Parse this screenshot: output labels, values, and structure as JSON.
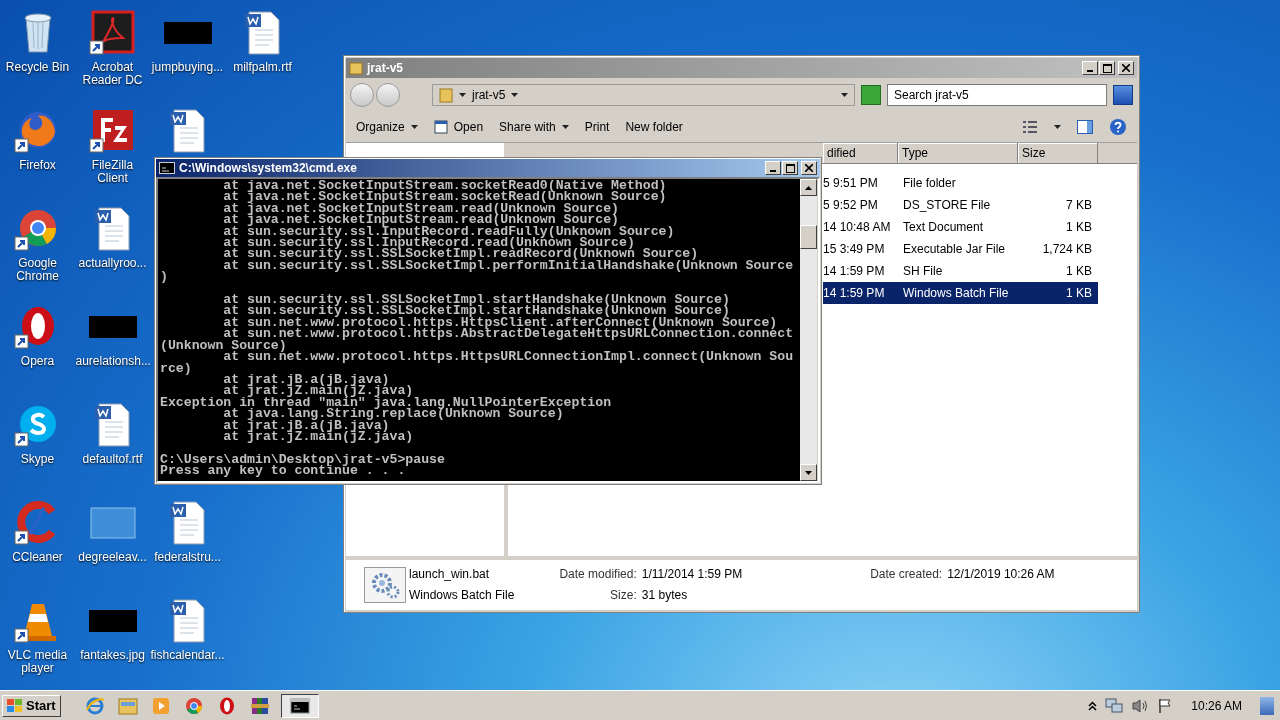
{
  "desktop": {
    "columns": [
      [
        {
          "kind": "recycle",
          "label": "Recycle Bin",
          "shortcut": false
        },
        {
          "kind": "firefox",
          "label": "Firefox",
          "shortcut": true
        },
        {
          "kind": "chrome",
          "label": "Google Chrome",
          "shortcut": true
        },
        {
          "kind": "opera",
          "label": "Opera",
          "shortcut": true
        },
        {
          "kind": "skype",
          "label": "Skype",
          "shortcut": true
        },
        {
          "kind": "ccleaner",
          "label": "CCleaner",
          "shortcut": true
        },
        {
          "kind": "vlc",
          "label": "VLC media player",
          "shortcut": true
        }
      ],
      [
        {
          "kind": "acrobat",
          "label": "Acrobat Reader DC",
          "shortcut": true
        },
        {
          "kind": "filezilla",
          "label": "FileZilla Client",
          "shortcut": true
        },
        {
          "kind": "word",
          "label": "actuallyroo...",
          "shortcut": false
        },
        {
          "kind": "thumb-dark",
          "label": "aurelationsh...",
          "shortcut": false
        },
        {
          "kind": "word",
          "label": "defaultof.rtf",
          "shortcut": false
        },
        {
          "kind": "thumb-light",
          "label": "degreeleav...",
          "shortcut": false
        },
        {
          "kind": "thumb-dark",
          "label": "fantakes.jpg",
          "shortcut": false
        }
      ],
      [
        {
          "kind": "thumb-dark",
          "label": "jumpbuying...",
          "shortcut": false
        },
        {
          "kind": "word",
          "shortcut": false
        },
        {
          "kind": "word",
          "label": "federalstru...",
          "shortcut": false
        },
        {
          "kind": "word",
          "label": "fishcalendar...",
          "shortcut": false
        }
      ],
      [
        {
          "kind": "word",
          "label": "milfpalm.rtf",
          "shortcut": false
        }
      ]
    ]
  },
  "explorer": {
    "title": "jrat-v5",
    "breadcrumb": "jrat-v5",
    "search": {
      "placeholder": "Search jrat-v5"
    },
    "toolbar": [
      {
        "kind": "menu",
        "label": "Organize"
      },
      {
        "kind": "open",
        "label": "Open"
      },
      {
        "kind": "menu",
        "label": "Share with"
      },
      {
        "kind": "plain",
        "label": "Print"
      },
      {
        "kind": "plain",
        "label": "New folder"
      }
    ],
    "columns": [
      "dified",
      "Type",
      "Size"
    ],
    "rows": [
      {
        "date": "5 9:51 PM",
        "type": "File folder",
        "selected": false
      },
      {
        "date": "5 9:52 PM",
        "type": "DS_STORE File",
        "size": "7 KB",
        "selected": false
      },
      {
        "date": "14 10:48 AM",
        "type": "Text Document",
        "size": "1 KB",
        "selected": false
      },
      {
        "date": "15 3:49 PM",
        "type": "Executable Jar File",
        "size": "1,724 KB",
        "selected": false
      },
      {
        "date": "14 1:59 PM",
        "type": "SH File",
        "size": "1 KB",
        "selected": false
      },
      {
        "date": "14 1:59 PM",
        "type": "Windows Batch File",
        "size": "1 KB",
        "selected": true
      }
    ],
    "details": {
      "name": "launch_win.bat",
      "type": "Windows Batch File",
      "fields": [
        {
          "label": "Date modified:",
          "value": "1/11/2014 1:59 PM"
        },
        {
          "label": "Date created:",
          "value": "12/1/2019 10:26 AM"
        },
        {
          "label": "Size:",
          "value": "31 bytes"
        }
      ]
    }
  },
  "console": {
    "title": "C:\\Windows\\system32\\cmd.exe",
    "output": "        at java.net.SocketInputStream.socketRead0(Native Method)\n        at java.net.SocketInputStream.socketRead(Unknown Source)\n        at java.net.SocketInputStream.read(Unknown Source)\n        at java.net.SocketInputStream.read(Unknown Source)\n        at sun.security.ssl.InputRecord.readFully(Unknown Source)\n        at sun.security.ssl.InputRecord.read(Unknown Source)\n        at sun.security.ssl.SSLSocketImpl.readRecord(Unknown Source)\n        at sun.security.ssl.SSLSocketImpl.performInitialHandshake(Unknown Source\n)\n\n        at sun.security.ssl.SSLSocketImpl.startHandshake(Unknown Source)\n        at sun.security.ssl.SSLSocketImpl.startHandshake(Unknown Source)\n        at sun.net.www.protocol.https.HttpsClient.afterConnect(Unknown Source)\n        at sun.net.www.protocol.https.AbstractDelegateHttpsURLConnection.connect\n(Unknown Source)\n        at sun.net.www.protocol.https.HttpsURLConnectionImpl.connect(Unknown Sou\nrce)\n        at jrat.jB.a(jB.java)\n        at jrat.jZ.main(jZ.java)\nException in thread \"main\" java.lang.NullPointerException\n        at java.lang.String.replace(Unknown Source)\n        at jrat.jB.a(jB.java)\n        at jrat.jZ.main(jZ.java)\n\nC:\\Users\\admin\\Desktop\\jrat-v5>pause\nPress any key to continue . . ."
  },
  "taskbar": {
    "start": "Start",
    "apps": [
      {
        "kind": "ie",
        "selected": false
      },
      {
        "kind": "folder",
        "selected": false
      },
      {
        "kind": "media",
        "selected": false
      },
      {
        "kind": "chrome",
        "selected": false
      },
      {
        "kind": "opera",
        "selected": false
      },
      {
        "kind": "archive",
        "selected": false
      },
      {
        "kind": "console",
        "selected": true
      }
    ],
    "clock": "10:26 AM"
  }
}
